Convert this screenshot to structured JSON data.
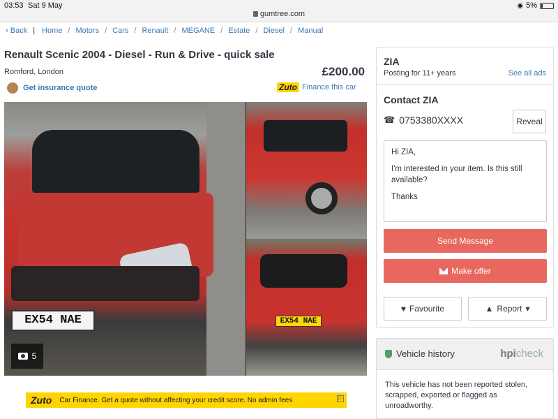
{
  "status_bar": {
    "time": "03:53",
    "date": "Sat 9 May",
    "url": "gumtree.com",
    "battery": "5%"
  },
  "breadcrumb": {
    "back": "Back",
    "items": [
      "Home",
      "Motors",
      "Cars",
      "Renault",
      "MEGANE",
      "Estate",
      "Diesel",
      "Manual"
    ]
  },
  "listing": {
    "title": "Renault Scenic 2004 - Diesel - Run & Drive - quick sale",
    "location": "Romford, London",
    "price": "£200.00",
    "insurance_link": "Get insurance quote",
    "finance_brand": "Zuto",
    "finance_link": "Finance this car"
  },
  "gallery": {
    "photo_count": "5",
    "front_plate": "EX54 NAE",
    "rear_plate": "EX54 NAE"
  },
  "ad_banner": {
    "brand": "Zuto",
    "text": "Car Finance. Get a quote without affecting your credit score. No admin fees"
  },
  "seller": {
    "name": "ZIA",
    "posting_duration": "Posting for 11+ years",
    "see_all": "See all ads",
    "contact_title": "Contact ZIA",
    "phone": "0753380XXXX",
    "reveal": "Reveal",
    "message_lines": [
      "Hi ZIA,",
      "I'm interested in your item. Is this still available?",
      "Thanks"
    ],
    "send_label": "Send Message",
    "offer_label": "Make offer",
    "favourite_label": "Favourite",
    "report_label": "Report"
  },
  "vehicle_history": {
    "title": "Vehicle history",
    "hpi_brand": "hpi",
    "hpi_check": "check",
    "text": "This vehicle has not been reported stolen, scrapped, exported or flagged as unroadworthy."
  },
  "colors": {
    "link": "#3c78b5",
    "accent": "#e8675f",
    "text": "#3c3241",
    "zuto_yellow": "#ffd400"
  }
}
